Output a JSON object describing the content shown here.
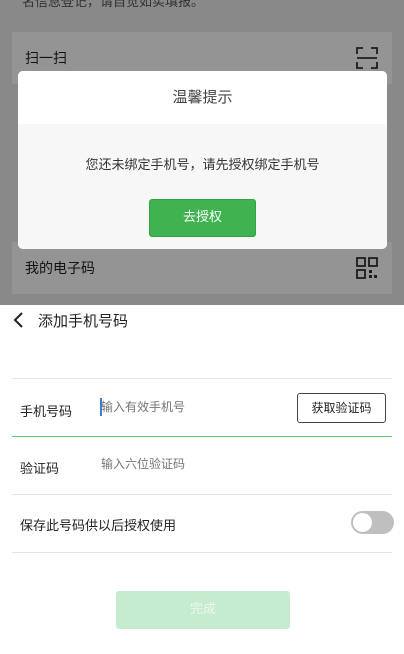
{
  "background_screen": {
    "notice_text": "名信息登记，请自觉如实填报。",
    "scan_label": "扫一扫",
    "my_code_label": "我的电子码"
  },
  "dialog": {
    "title": "温馨提示",
    "message": "您还未绑定手机号，请先授权绑定手机号",
    "button_label": "去授权",
    "button_color": "#3eb34f"
  },
  "form": {
    "title": "添加手机号码",
    "phone_label": "手机号码",
    "phone_placeholder": "输入有效手机号",
    "get_code_label": "获取验证码",
    "code_label": "验证码",
    "code_placeholder": "输入六位验证码",
    "save_label": "保存此号码供以后授权使用",
    "save_toggle_on": false,
    "submit_label": "完成",
    "accent_color": "#59c879"
  }
}
